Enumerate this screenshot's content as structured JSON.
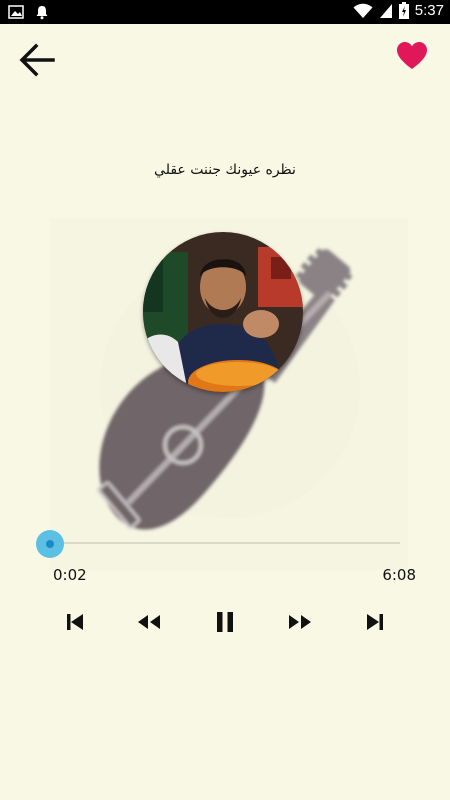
{
  "status_bar": {
    "time": "5:37",
    "left_icons": [
      "image-icon",
      "notification-bell-icon"
    ],
    "right_icons": [
      "wifi-icon",
      "signal-icon",
      "battery-icon"
    ]
  },
  "top_bar": {
    "back_icon": "arrow-left-icon",
    "favorite_icon": "heart-icon",
    "favorite_color": "#e0185a"
  },
  "song": {
    "title": "نظره عيونك جننت عقلي"
  },
  "player": {
    "current_time": "0:02",
    "total_time": "6:08",
    "progress": 0.005,
    "accent_color": "#5bc0e4",
    "controls": [
      "skip-previous-icon",
      "rewind-icon",
      "pause-icon",
      "fast-forward-icon",
      "skip-next-icon"
    ]
  }
}
